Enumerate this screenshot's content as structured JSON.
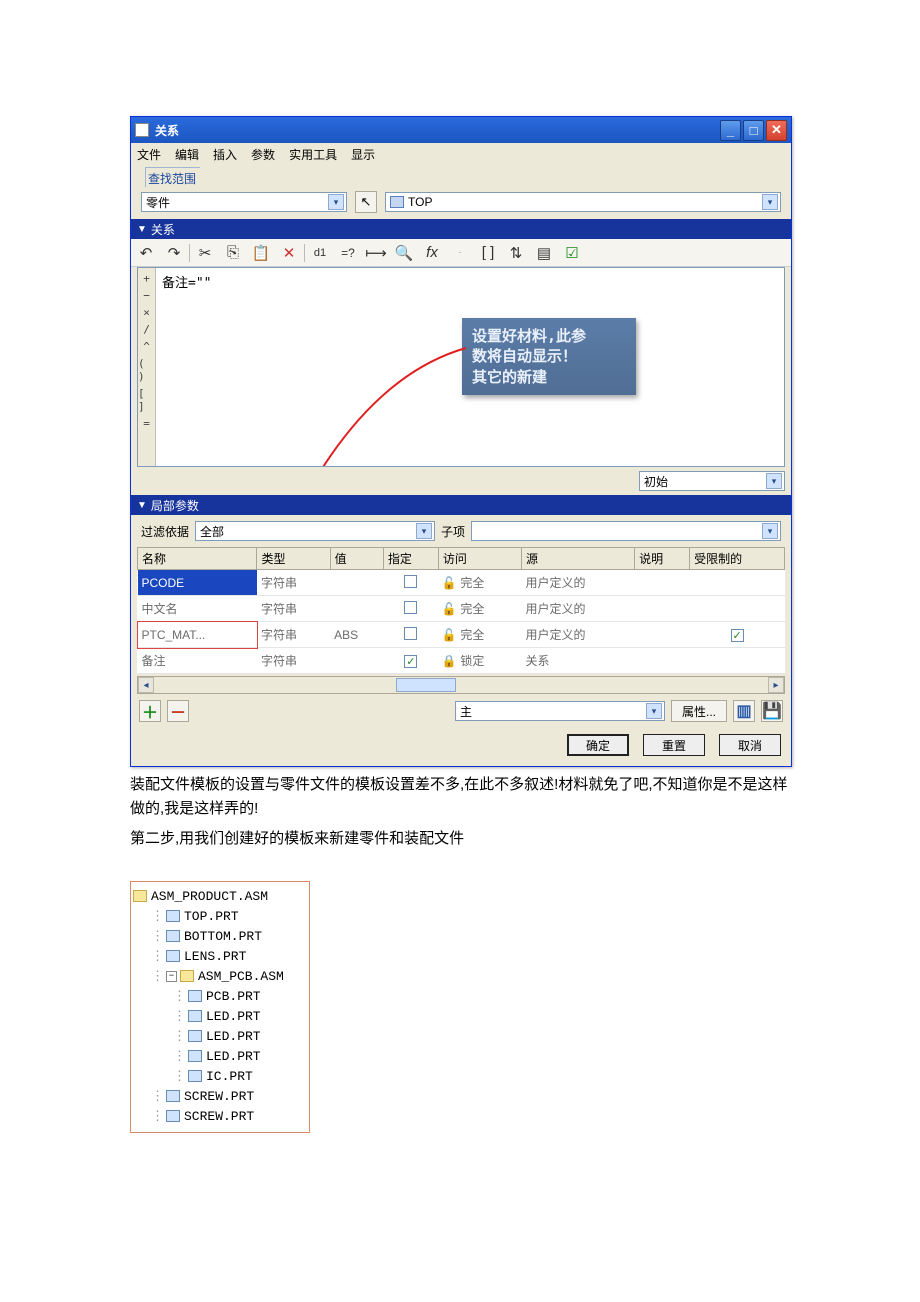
{
  "titlebar": {
    "title": "关系"
  },
  "menu": {
    "file": "文件",
    "edit": "编辑",
    "insert": "插入",
    "params": "参数",
    "tools": "实用工具",
    "display": "显示"
  },
  "scope": {
    "label": "查找范围",
    "type": "零件",
    "target": "TOP"
  },
  "section": {
    "relations": "关系",
    "local_params": "局部参数"
  },
  "gutter": [
    "+",
    "−",
    "×",
    "/",
    "^",
    "( )",
    "[ ]",
    "="
  ],
  "relation_text": "备注=\"\"",
  "callout": {
    "line1": "设置好材料,此参",
    "line2": "数将自动显示！",
    "line3": "其它的新建"
  },
  "initial": "初始",
  "filter": {
    "label": "过滤依据",
    "value": "全部",
    "sub_label": "子项"
  },
  "columns": {
    "name": "名称",
    "type": "类型",
    "value": "值",
    "designate": "指定",
    "access": "访问",
    "source": "源",
    "desc": "说明",
    "restricted": "受限制的"
  },
  "rows": [
    {
      "name": "PCODE",
      "type": "字符串",
      "value": "",
      "designate": false,
      "access": "完全",
      "access_icon": "lock-open",
      "source": "用户定义的",
      "restricted": false,
      "sel": true
    },
    {
      "name": "中文名",
      "type": "字符串",
      "value": "",
      "designate": false,
      "access": "完全",
      "access_icon": "lock-open",
      "source": "用户定义的",
      "restricted": false
    },
    {
      "name": "PTC_MAT...",
      "type": "字符串",
      "value": "ABS",
      "designate": false,
      "access": "完全",
      "access_icon": "lock-open",
      "source": "用户定义的",
      "restricted": true,
      "hl": true
    },
    {
      "name": "备注",
      "type": "字符串",
      "value": "",
      "designate": true,
      "access": "锁定",
      "access_icon": "lock-closed",
      "source": "关系",
      "restricted": false
    }
  ],
  "bottom": {
    "main_label": "主",
    "props": "属性..."
  },
  "dlg_buttons": {
    "ok": "确定",
    "reset": "重置",
    "cancel": "取消"
  },
  "body_text": {
    "p1": "装配文件模板的设置与零件文件的模板设置差不多,在此不多叙述!材料就免了吧,不知道你是不是这样做的,我是这样弄的!",
    "p2": "第二步,用我们创建好的模板来新建零件和装配文件"
  },
  "tree": [
    {
      "level": 0,
      "icon": "asm",
      "label": "ASM_PRODUCT.ASM"
    },
    {
      "level": 1,
      "icon": "prt",
      "label": "TOP.PRT"
    },
    {
      "level": 1,
      "icon": "prt",
      "label": "BOTTOM.PRT"
    },
    {
      "level": 1,
      "icon": "prt",
      "label": "LENS.PRT"
    },
    {
      "level": 1,
      "icon": "asm",
      "label": "ASM_PCB.ASM",
      "toggle": "−"
    },
    {
      "level": 2,
      "icon": "prt",
      "label": "PCB.PRT"
    },
    {
      "level": 2,
      "icon": "prt",
      "label": "LED.PRT"
    },
    {
      "level": 2,
      "icon": "prt",
      "label": "LED.PRT"
    },
    {
      "level": 2,
      "icon": "prt",
      "label": "LED.PRT"
    },
    {
      "level": 2,
      "icon": "prt",
      "label": "IC.PRT"
    },
    {
      "level": 1,
      "icon": "prt",
      "label": "SCREW.PRT"
    },
    {
      "level": 1,
      "icon": "prt",
      "label": "SCREW.PRT"
    }
  ]
}
